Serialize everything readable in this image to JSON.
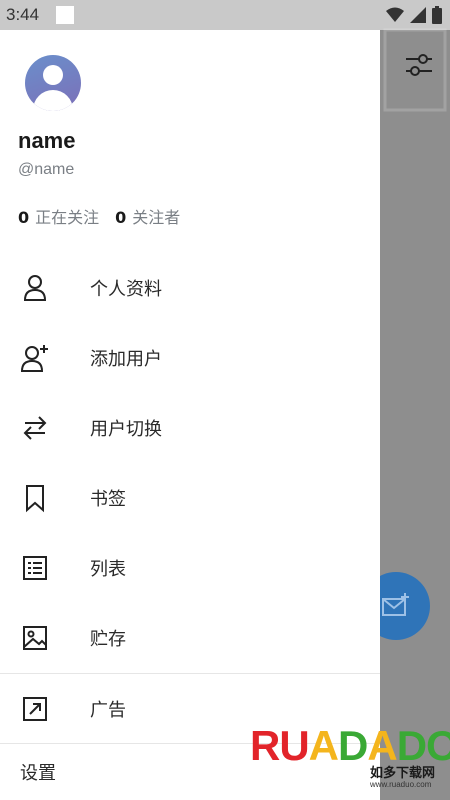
{
  "status_bar": {
    "time": "3:44"
  },
  "profile": {
    "name": "name",
    "handle": "@name",
    "following_count": "0",
    "following_label": "正在关注",
    "followers_count": "0",
    "followers_label": "关注者"
  },
  "menu": {
    "items": [
      {
        "label": "个人资料",
        "icon": "person-icon"
      },
      {
        "label": "添加用户",
        "icon": "add-user-icon"
      },
      {
        "label": "用户切换",
        "icon": "switch-arrows-icon"
      },
      {
        "label": "书签",
        "icon": "bookmark-icon"
      },
      {
        "label": "列表",
        "icon": "list-icon"
      },
      {
        "label": "贮存",
        "icon": "image-icon"
      },
      {
        "label": "广告",
        "icon": "external-link-icon"
      },
      {
        "label": "设置",
        "icon": ""
      }
    ]
  },
  "brand": {
    "letters": "RUADADO",
    "tagline": "如多下载网",
    "url": "www.ruaduo.com"
  },
  "colors": {
    "fab": "#2f74b8",
    "drawer_bg": "#ffffff",
    "scrim": "#8e8e8e"
  }
}
